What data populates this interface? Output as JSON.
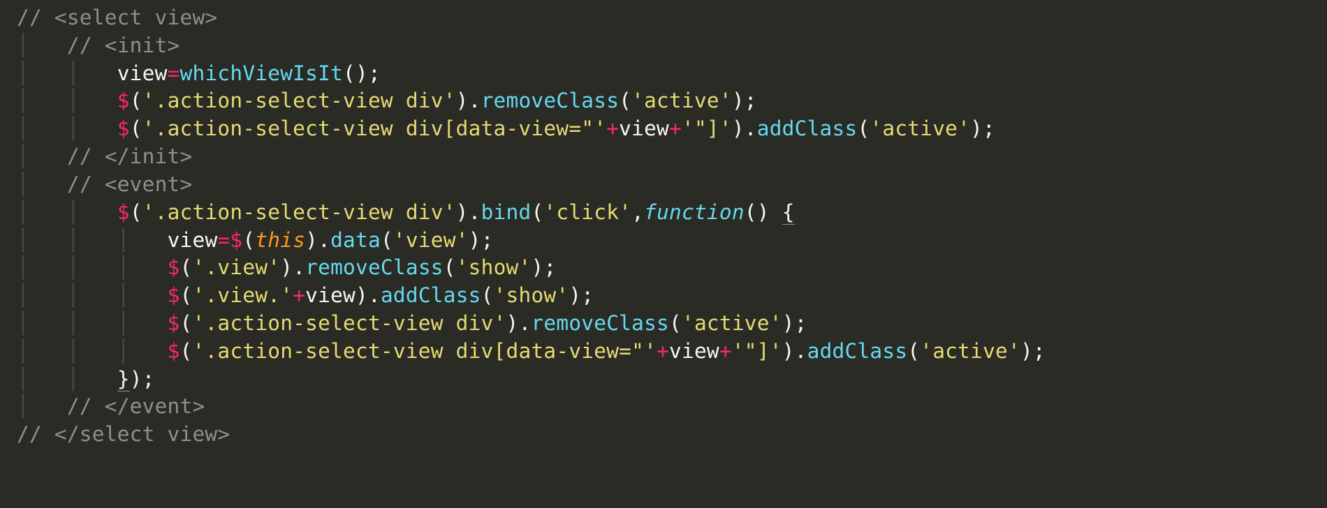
{
  "code": {
    "lines": [
      {
        "indent": 0,
        "type": "comment",
        "text": "// <select view>"
      },
      {
        "indent": 1,
        "type": "comment",
        "text": "// <init>"
      },
      {
        "indent": 2,
        "type": "stmt_assign_call",
        "lhs": "view",
        "rhs_fn": "whichViewIsIt"
      },
      {
        "indent": 2,
        "type": "jq_call",
        "selector": "'.action-select-view div'",
        "method": "removeClass",
        "arg": "'active'"
      },
      {
        "indent": 2,
        "type": "jq_call_concat",
        "sel_a": "'.action-select-view div[data-view=\"'",
        "concat_var": "view",
        "sel_b": "'\"]'",
        "method": "addClass",
        "arg": "'active'"
      },
      {
        "indent": 1,
        "type": "comment",
        "text": "// </init>"
      },
      {
        "indent": 1,
        "type": "comment",
        "text": "// <event>"
      },
      {
        "indent": 2,
        "type": "jq_bind_open",
        "selector": "'.action-select-view div'",
        "event": "'click'"
      },
      {
        "indent": 3,
        "type": "stmt_assign_jqdata",
        "lhs": "view",
        "arg": "'view'"
      },
      {
        "indent": 3,
        "type": "jq_call",
        "selector": "'.view'",
        "method": "removeClass",
        "arg": "'show'"
      },
      {
        "indent": 3,
        "type": "jq_call_concat2",
        "sel_a": "'.view.'",
        "concat_var": "view",
        "method": "addClass",
        "arg": "'show'"
      },
      {
        "indent": 3,
        "type": "jq_call",
        "selector": "'.action-select-view div'",
        "method": "removeClass",
        "arg": "'active'"
      },
      {
        "indent": 3,
        "type": "jq_call_concat",
        "sel_a": "'.action-select-view div[data-view=\"'",
        "concat_var": "view",
        "sel_b": "'\"]'",
        "method": "addClass",
        "arg": "'active'"
      },
      {
        "indent": 2,
        "type": "close_bind"
      },
      {
        "indent": 1,
        "type": "comment",
        "text": "// </event>"
      },
      {
        "indent": 0,
        "type": "comment",
        "text": "// </select view>"
      }
    ]
  }
}
